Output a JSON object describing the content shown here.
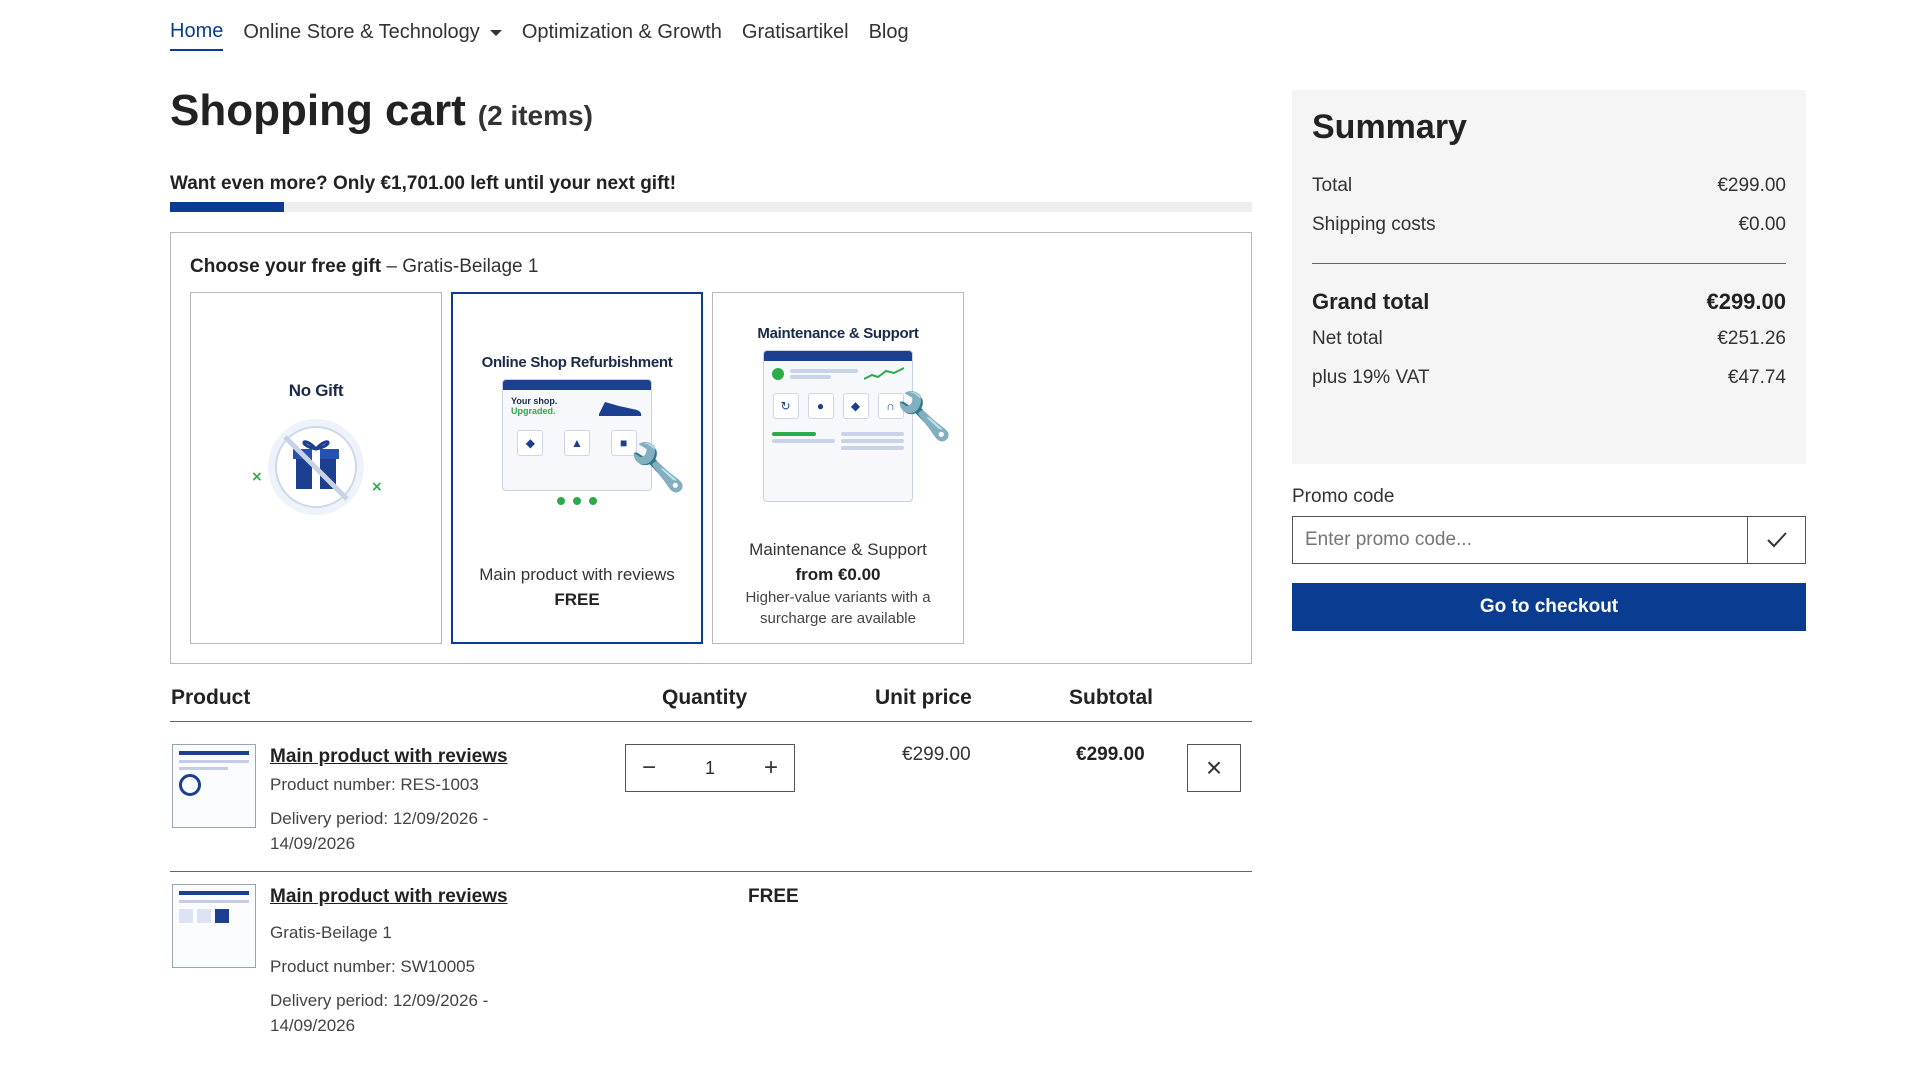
{
  "nav": {
    "items": [
      {
        "label": "Home",
        "active": true
      },
      {
        "label": "Online Store & Technology",
        "dropdown": true
      },
      {
        "label": "Optimization & Growth"
      },
      {
        "label": "Gratisartikel"
      },
      {
        "label": "Blog"
      }
    ]
  },
  "cart": {
    "title": "Shopping cart",
    "count": "(2 items)",
    "gift_message": "Want even more? Only €1,701.00 left until your next gift!",
    "gift_progress": 0.105
  },
  "gift_panel": {
    "heading_bold": "Choose your free gift",
    "heading_rest": " – Gratis-Beilage 1",
    "cards": [
      {
        "image_title": "No Gift"
      },
      {
        "image_title": "Online Shop Refurbishment",
        "image_tag1": "Your shop.",
        "image_tag2": "Upgraded.",
        "name": "Main product with reviews",
        "price": "FREE",
        "selected": true
      },
      {
        "image_title": "Maintenance & Support",
        "name": "Maintenance & Support",
        "price": "from €0.00",
        "note": "Higher-value variants with a surcharge are available"
      }
    ]
  },
  "table": {
    "headers": {
      "product": "Product",
      "quantity": "Quantity",
      "unit_price": "Unit price",
      "subtotal": "Subtotal"
    },
    "rows": [
      {
        "name": "Main product with reviews",
        "product_number": "Product number: RES-1003",
        "delivery_1": "Delivery period: 12/09/2026 -",
        "delivery_2": "14/09/2026",
        "quantity": "1",
        "unit_price": "€299.00",
        "subtotal": "€299.00"
      },
      {
        "name": "Main product with reviews",
        "variant": "Gratis-Beilage 1",
        "product_number": "Product number: SW10005",
        "delivery_1": "Delivery period: 12/09/2026 -",
        "delivery_2": "14/09/2026",
        "price_label": "FREE"
      }
    ]
  },
  "summary": {
    "title": "Summary",
    "total_label": "Total",
    "total_value": "€299.00",
    "shipping_label": "Shipping costs",
    "shipping_value": "€0.00",
    "grand_label": "Grand total",
    "grand_value": "€299.00",
    "net_label": "Net total",
    "net_value": "€251.26",
    "vat_label": "plus 19% VAT",
    "vat_value": "€47.74"
  },
  "promo": {
    "label": "Promo code",
    "placeholder": "Enter promo code...",
    "apply_icon": "check-icon"
  },
  "checkout": {
    "label": "Go to checkout"
  },
  "colors": {
    "accent": "#0a3d91",
    "panel_bg": "#f5f5f5",
    "success": "#2bab4a"
  }
}
